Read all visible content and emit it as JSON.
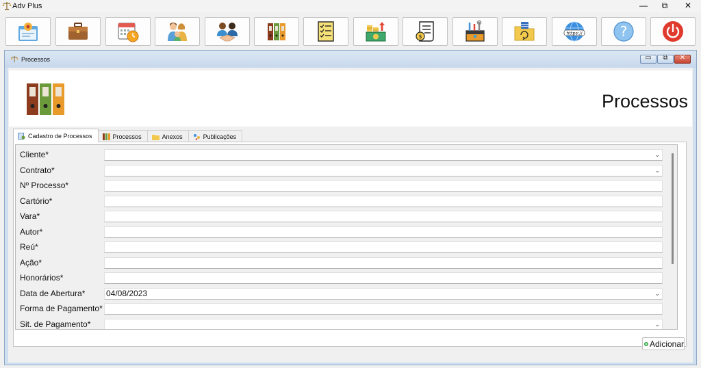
{
  "window": {
    "app_title": "Adv Plus",
    "minimize": "—",
    "maximize": "⧉",
    "close": "✕"
  },
  "toolbar": {
    "buttons": [
      {
        "icon": "client-card-icon"
      },
      {
        "icon": "briefcase-icon"
      },
      {
        "icon": "calendar-clock-icon"
      },
      {
        "icon": "family-icon"
      },
      {
        "icon": "handshake-icon"
      },
      {
        "icon": "binders-icon"
      },
      {
        "icon": "checklist-document-icon"
      },
      {
        "icon": "finance-money-icon"
      },
      {
        "icon": "receipt-coin-icon"
      },
      {
        "icon": "toolbox-icon"
      },
      {
        "icon": "folder-database-icon"
      },
      {
        "icon": "https-globe-icon"
      },
      {
        "icon": "help-icon"
      },
      {
        "icon": "power-icon"
      }
    ]
  },
  "child_window": {
    "title": "Processos",
    "minimize": "▭",
    "restore": "⧉",
    "close": "✕"
  },
  "header": {
    "title": "Processos",
    "logo_icon": "binders-icon"
  },
  "tabs": [
    {
      "label": "Cadastro de Processos",
      "icon": "register-icon",
      "active": true
    },
    {
      "label": "Processos",
      "icon": "binders-icon",
      "active": false
    },
    {
      "label": "Anexos",
      "icon": "folder-icon",
      "active": false
    },
    {
      "label": "Publicações",
      "icon": "sparkle-icon",
      "active": false
    }
  ],
  "form": {
    "fields": [
      {
        "label": "Cliente*",
        "value": "",
        "type": "combo"
      },
      {
        "label": "Contrato*",
        "value": "",
        "type": "combo"
      },
      {
        "label": "Nº Processo*",
        "value": "",
        "type": "text"
      },
      {
        "label": "Cartório*",
        "value": "",
        "type": "text"
      },
      {
        "label": "Vara*",
        "value": "",
        "type": "text"
      },
      {
        "label": "Autor*",
        "value": "",
        "type": "text"
      },
      {
        "label": "Reú*",
        "value": "",
        "type": "text"
      },
      {
        "label": "Ação*",
        "value": "",
        "type": "text"
      },
      {
        "label": "Honorários*",
        "value": "",
        "type": "text"
      },
      {
        "label": "Data de Abertura*",
        "value": "04/08/2023",
        "type": "combo"
      },
      {
        "label": "Forma de Pagamento*",
        "value": "",
        "type": "text"
      },
      {
        "label": "Sit. de Pagamento*",
        "value": "",
        "type": "combo"
      }
    ],
    "add_button": "Adicionar",
    "caret": "⌄"
  },
  "colors": {
    "accent_blue": "#cfdff0",
    "add_green": "#2aa63a",
    "power_red": "#e03a2e"
  }
}
